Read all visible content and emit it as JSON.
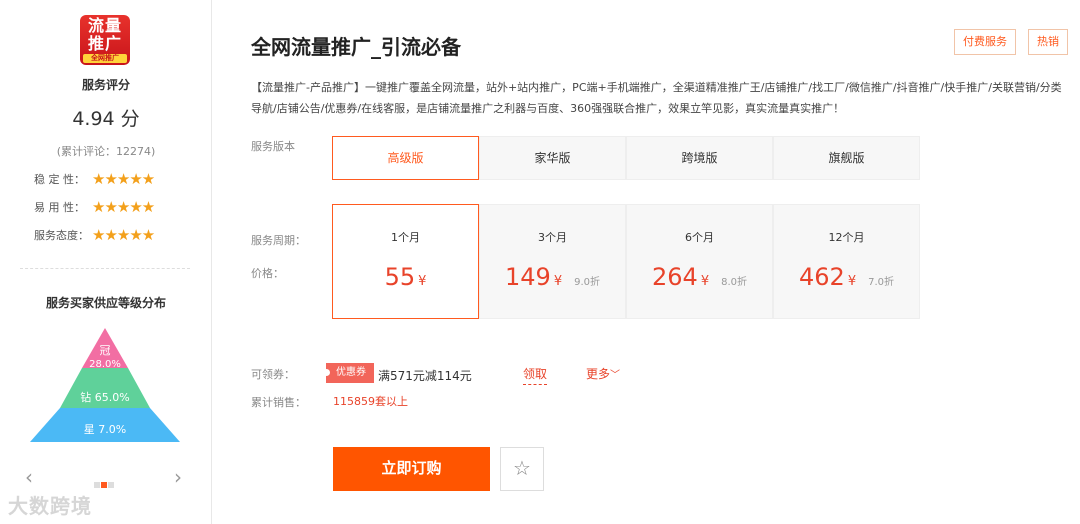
{
  "sidebar": {
    "logo": {
      "line1": "流量",
      "line2": "推广",
      "badge": "全网推广"
    },
    "score_title": "服务评分",
    "score_value": "4.94 分",
    "review_count": "(累计评论：12274)",
    "ratings": [
      {
        "label": "稳 定 性：",
        "stars": "★★★★★"
      },
      {
        "label": "易 用 性：",
        "stars": "★★★★★"
      },
      {
        "label": "服务态度：",
        "stars": "★★★★★"
      }
    ],
    "distribution_title": "服务买家供应等级分布",
    "distribution": [
      {
        "name": "冠",
        "percent": "28.0%",
        "color": "#f26ea3"
      },
      {
        "name": "钻",
        "percent": "65.0%",
        "color": "#5fd19a"
      },
      {
        "name": "星",
        "percent": "7.0%",
        "color": "#4bb9f5"
      }
    ],
    "prev_icon": "‹",
    "next_icon": "›",
    "watermark": "大数跨境"
  },
  "header": {
    "title": "全网流量推广_引流必备",
    "tags": [
      "付费服务",
      "热销"
    ]
  },
  "description": "【流量推广-产品推广】一键推广覆盖全网流量，站外+站内推广，PC端+手机端推广，全渠道精准推广王/店铺推广/找工厂/微信推广/抖音推广/快手推广/关联营销/分类导航/店铺公告/优惠券/在线客服，是店铺流量推广之利器与百度、360强强联合推广，效果立竿见影，真实流量真实推广！",
  "labels": {
    "version": "服务版本",
    "period": "服务周期：",
    "price": "价格：",
    "coupon": "可领券：",
    "sales": "累计销售："
  },
  "versions": [
    "高级版",
    "家华版",
    "跨境版",
    "旗舰版"
  ],
  "periods": [
    {
      "months": "1个月",
      "price": "55",
      "currency": "¥",
      "discount": ""
    },
    {
      "months": "3个月",
      "price": "149",
      "currency": "¥",
      "discount": "9.0折"
    },
    {
      "months": "6个月",
      "price": "264",
      "currency": "¥",
      "discount": "8.0折"
    },
    {
      "months": "12个月",
      "price": "462",
      "currency": "¥",
      "discount": "7.0折"
    }
  ],
  "coupon": {
    "tag": "优惠券",
    "text": "满571元减114元",
    "get": "领取",
    "more": "更多",
    "more_icon": "﹀"
  },
  "sales": "115859套以上",
  "actions": {
    "buy": "立即订购",
    "favorite_icon": "☆"
  }
}
